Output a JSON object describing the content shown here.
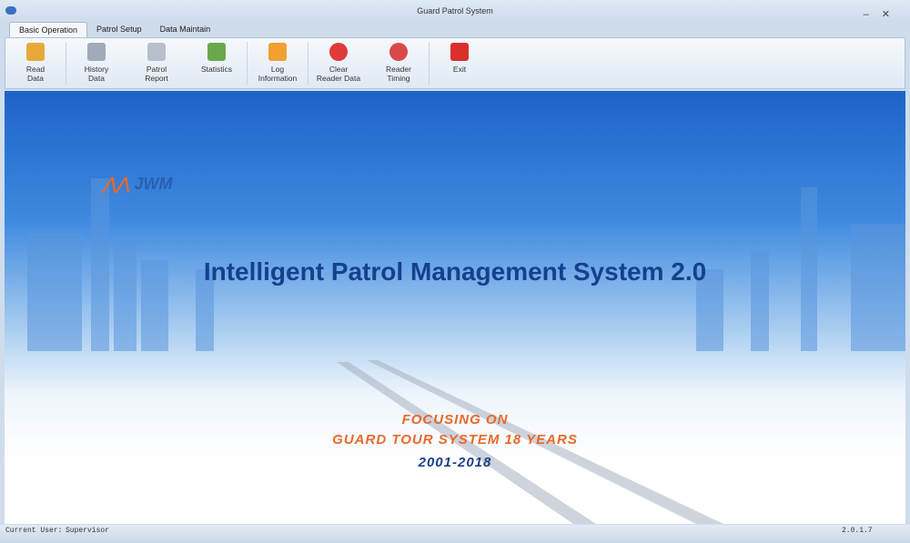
{
  "window": {
    "title": "Guard Patrol System"
  },
  "tabs": [
    {
      "label": "Basic Operation",
      "active": true
    },
    {
      "label": "Patrol Setup"
    },
    {
      "label": "Data Maintain"
    }
  ],
  "ribbon": [
    {
      "label": "Read\nData",
      "icon": "folder-gear-icon",
      "color": "#e8a93a"
    },
    {
      "label": "History\nData",
      "icon": "history-stopwatch-icon",
      "color": "#a0aab8"
    },
    {
      "label": "Patrol\nReport",
      "icon": "report-icon",
      "color": "#b8c0cc"
    },
    {
      "label": "Statistics",
      "icon": "bar-chart-icon",
      "color": "#6aa84f"
    },
    {
      "label": "Log\nInformation",
      "icon": "log-icon",
      "color": "#f0a030"
    },
    {
      "label": "Clear\nReader Data",
      "icon": "clear-x-icon",
      "color": "#e03a3a"
    },
    {
      "label": "Reader\nTiming",
      "icon": "clock-icon",
      "color": "#d84a4a"
    },
    {
      "label": "Exit",
      "icon": "power-icon",
      "color": "#d8302a"
    }
  ],
  "banner": {
    "logo": "JWM",
    "headline": "Intelligent Patrol Management System 2.0",
    "tag1": "FOCUSING ON",
    "tag2": "GUARD TOUR SYSTEM 18 YEARS",
    "years": "2001-2018"
  },
  "status": {
    "user_label": "Current User:",
    "user": "Supervisor",
    "version": "2.0.1.7"
  }
}
